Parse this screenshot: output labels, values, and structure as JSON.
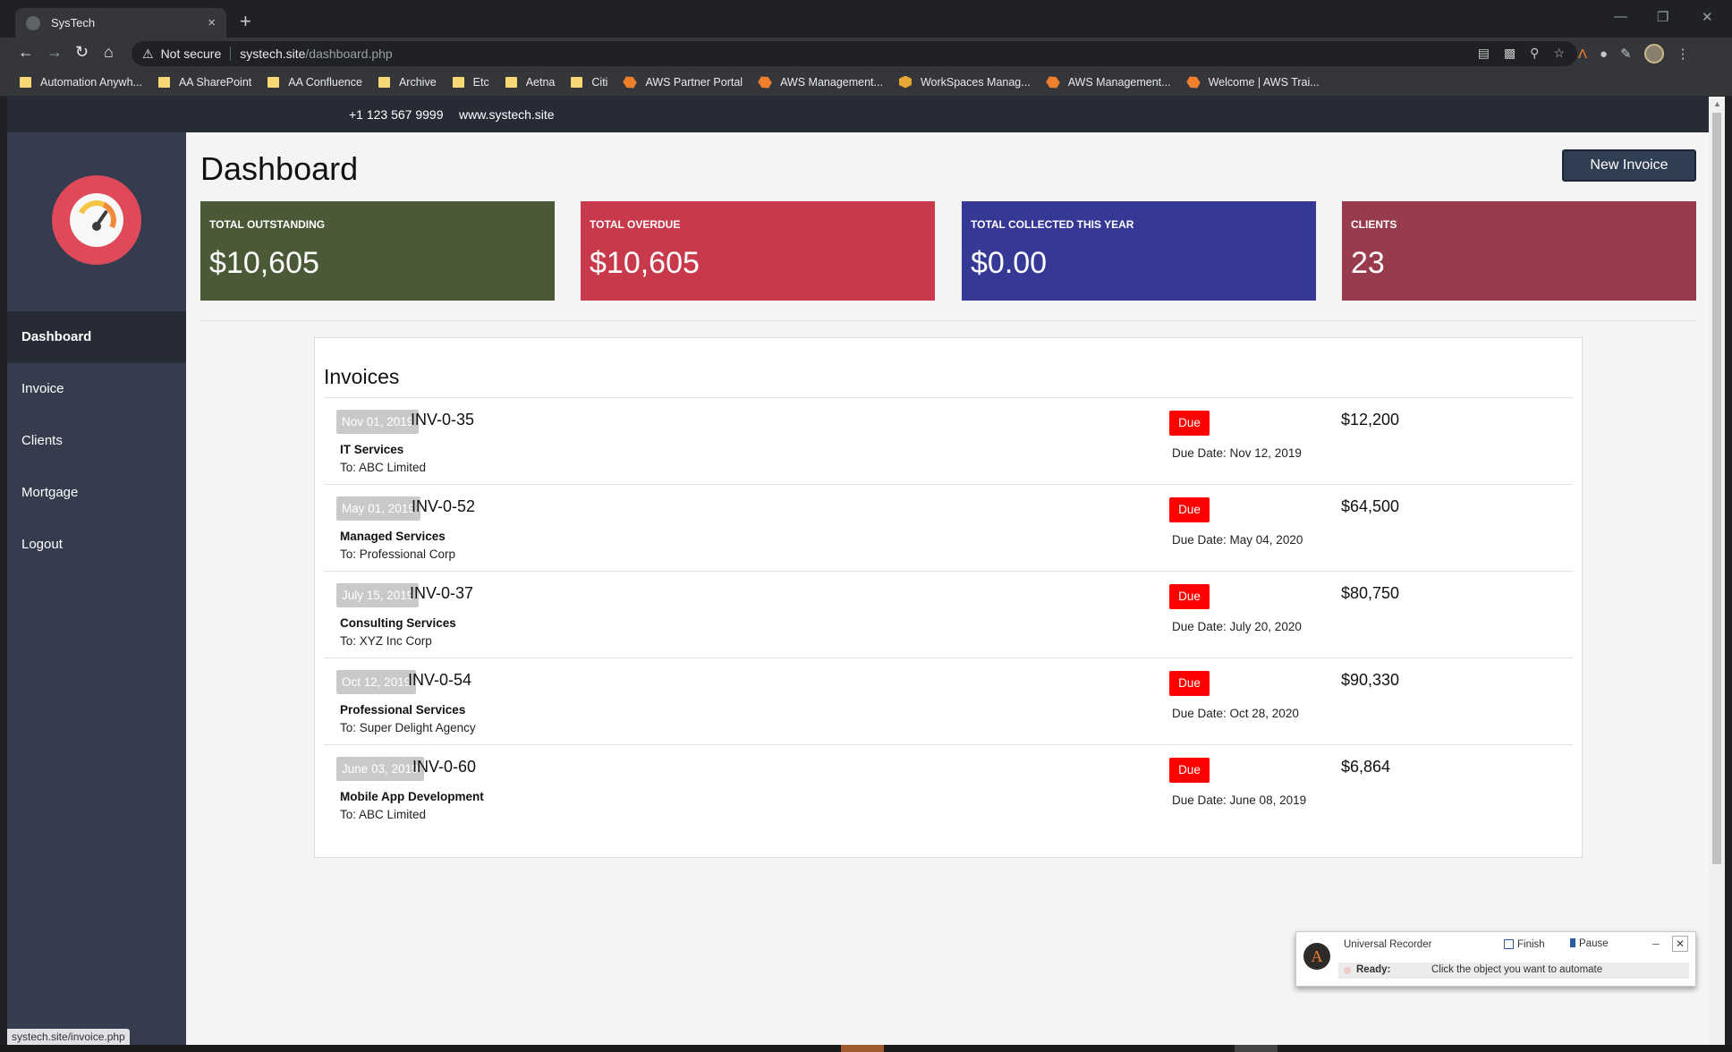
{
  "browser": {
    "tab_title": "SysTech",
    "tab_close": "×",
    "new_tab": "+",
    "security_label": "Not secure",
    "url_host": "systech.site",
    "url_path": "/dashboard.php",
    "status_url": "systech.site/invoice.php"
  },
  "bookmarks": [
    {
      "label": "Automation Anywh...",
      "icon": "folder-icon"
    },
    {
      "label": "AA SharePoint",
      "icon": "folder-icon"
    },
    {
      "label": "AA Confluence",
      "icon": "folder-icon"
    },
    {
      "label": "Archive",
      "icon": "folder-icon"
    },
    {
      "label": "Etc",
      "icon": "folder-icon"
    },
    {
      "label": "Aetna",
      "icon": "folder-icon"
    },
    {
      "label": "Citi",
      "icon": "folder-icon"
    },
    {
      "label": "AWS Partner Portal",
      "icon": "aws-icon"
    },
    {
      "label": "AWS Management...",
      "icon": "aws-icon"
    },
    {
      "label": "WorkSpaces Manag...",
      "icon": "workspaces-icon"
    },
    {
      "label": "AWS Management...",
      "icon": "aws-icon"
    },
    {
      "label": "Welcome | AWS Trai...",
      "icon": "aws-icon"
    }
  ],
  "topbar": {
    "phone": "+1 123 567 9999",
    "website": "www.systech.site"
  },
  "sidebar": {
    "items": [
      {
        "label": "Dashboard",
        "active": true
      },
      {
        "label": "Invoice",
        "active": false
      },
      {
        "label": "Clients",
        "active": false
      },
      {
        "label": "Mortgage",
        "active": false
      },
      {
        "label": "Logout",
        "active": false
      }
    ]
  },
  "main": {
    "title": "Dashboard",
    "new_invoice_label": "New Invoice"
  },
  "stats": [
    {
      "label": "TOTAL OUTSTANDING",
      "value": "$10,605",
      "color": "#4b5a36"
    },
    {
      "label": "TOTAL OVERDUE",
      "value": "$10,605",
      "color": "#c83a4b"
    },
    {
      "label": "TOTAL COLLECTED THIS YEAR",
      "value": "$0.00",
      "color": "#363896"
    },
    {
      "label": "CLIENTS",
      "value": "23",
      "color": "#983b4d"
    }
  ],
  "invoices": {
    "title": "Invoices",
    "rows": [
      {
        "date": "Nov 01, 2019",
        "number": "INV-0-35",
        "service": "IT Services",
        "to": "To: ABC Limited",
        "status": "Due",
        "due_date": "Due Date: Nov 12, 2019",
        "amount": "$12,200"
      },
      {
        "date": "May 01, 2019",
        "number": "INV-0-52",
        "service": "Managed Services",
        "to": "To: Professional Corp",
        "status": "Due",
        "due_date": "Due Date: May 04, 2020",
        "amount": "$64,500"
      },
      {
        "date": "July 15, 2019",
        "number": "INV-0-37",
        "service": "Consulting Services",
        "to": "To: XYZ Inc Corp",
        "status": "Due",
        "due_date": "Due Date: July 20, 2020",
        "amount": "$80,750"
      },
      {
        "date": "Oct 12, 2019",
        "number": "INV-0-54",
        "service": "Professional Services",
        "to": "To: Super Delight Agency",
        "status": "Due",
        "due_date": "Due Date: Oct 28, 2020",
        "amount": "$90,330"
      },
      {
        "date": "June 03, 2019",
        "number": "INV-0-60",
        "service": "Mobile App Development",
        "to": "To: ABC Limited",
        "status": "Due",
        "due_date": "Due Date: June 08, 2019",
        "amount": "$6,864"
      }
    ]
  },
  "recorder": {
    "title": "Universal Recorder",
    "finish_label": "Finish",
    "pause_label": "Pause",
    "status_label": "Ready:",
    "status_message": "Click the object you want to automate"
  }
}
